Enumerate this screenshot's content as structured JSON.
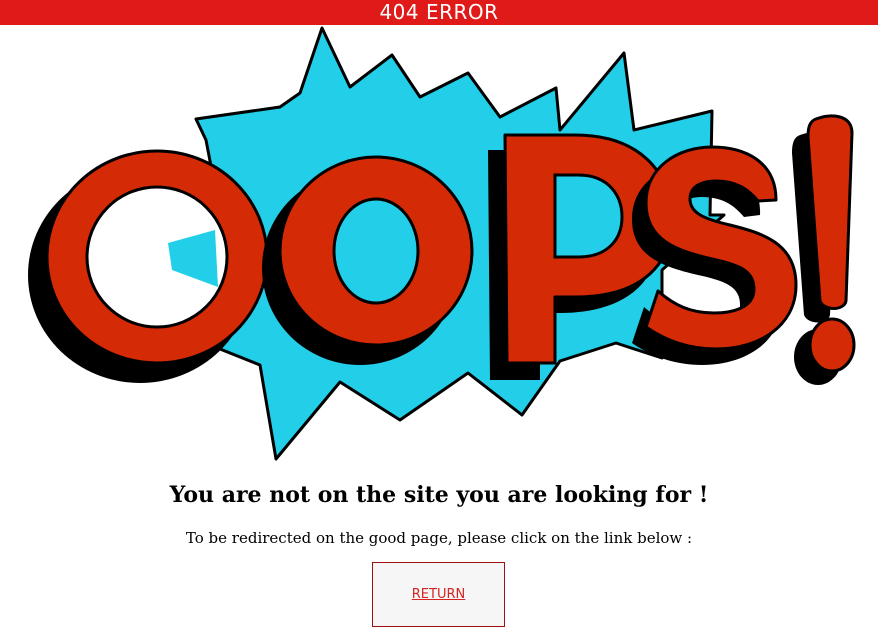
{
  "banner": {
    "title": "404 ERROR",
    "color": "#e01a18"
  },
  "illustration": {
    "word": "OOPs!",
    "burst_color": "#23cfe8",
    "letter_color": "#d42a05",
    "shadow_color": "#000000"
  },
  "message": {
    "headline": "You are not on the site you are looking for !",
    "subtext": "To be redirected on the good page, please click on the link below :"
  },
  "return_button": {
    "label": "RETURN"
  }
}
